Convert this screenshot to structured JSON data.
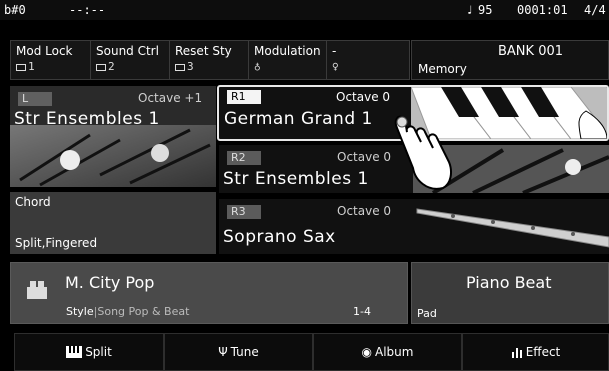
{
  "status": {
    "transpose": "b#0",
    "chord": "--:--",
    "tempo": "95",
    "time": "0001:01",
    "beat": "4/4"
  },
  "mode_buttons": [
    {
      "label": "Mod Lock",
      "sub": "1"
    },
    {
      "label": "Sound Ctrl",
      "sub": "2"
    },
    {
      "label": "Reset Sty",
      "sub": "3"
    },
    {
      "label": "Modulation",
      "sub": ""
    },
    {
      "label": "-",
      "sub": ""
    }
  ],
  "memory": {
    "bank": "BANK 001",
    "label": "Memory"
  },
  "voices": {
    "L": {
      "tag": "L",
      "octave": "Octave +1",
      "name": "Str Ensembles 1"
    },
    "R1": {
      "tag": "R1",
      "octave": "Octave 0",
      "name": "German Grand 1"
    },
    "R2": {
      "tag": "R2",
      "octave": "Octave 0",
      "name": "Str Ensembles 1"
    },
    "R3": {
      "tag": "R3",
      "octave": "Octave 0",
      "name": "Soprano Sax"
    }
  },
  "chord_panel": {
    "title": "Chord",
    "value": "Split,Fingered"
  },
  "style": {
    "name": "M. City Pop",
    "category": "Style",
    "sub": "Song Pop & Beat",
    "range": "1-4"
  },
  "beat": {
    "name": "Piano Beat",
    "label": "Pad"
  },
  "bottom": [
    {
      "label": "Split",
      "icon": "keyboard-icon"
    },
    {
      "label": "Tune",
      "icon": "tuning-fork-icon"
    },
    {
      "label": "Album",
      "icon": "disc-icon"
    },
    {
      "label": "Effect",
      "icon": "equalizer-icon"
    }
  ],
  "colors": {
    "accent_light": "#f2f2f2",
    "tag_dark": "#5b5b5b",
    "tag_light": "#f4f4f4"
  }
}
